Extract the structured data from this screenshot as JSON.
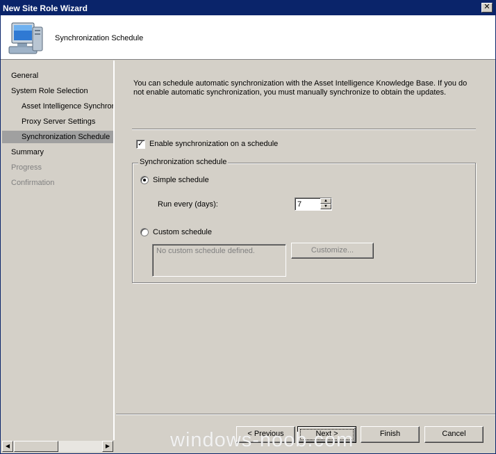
{
  "window": {
    "title": "New Site Role Wizard",
    "close_glyph": "✕"
  },
  "header": {
    "title": "Synchronization Schedule",
    "icon": "computer-monitor-icon"
  },
  "sidebar": {
    "items": [
      {
        "label": "General",
        "state": "normal"
      },
      {
        "label": "System Role Selection",
        "state": "normal"
      },
      {
        "label": "Asset Intelligence Synchron",
        "state": "normal"
      },
      {
        "label": "Proxy Server Settings",
        "state": "normal"
      },
      {
        "label": "Synchronization Schedule",
        "state": "selected"
      },
      {
        "label": "Summary",
        "state": "normal"
      },
      {
        "label": "Progress",
        "state": "disabled"
      },
      {
        "label": "Confirmation",
        "state": "disabled"
      }
    ]
  },
  "main": {
    "description": "You can schedule automatic synchronization with the Asset Intelligence Knowledge Base. If you do not enable automatic synchronization, you must manually synchronize to obtain the updates.",
    "enable_checkbox": {
      "label": "Enable synchronization on a schedule",
      "checked": true
    },
    "group": {
      "legend": "Synchronization schedule",
      "simple": {
        "label": "Simple schedule",
        "selected": true
      },
      "run_every_label": "Run every (days):",
      "run_every_value": "7",
      "custom": {
        "label": "Custom schedule",
        "selected": false
      },
      "custom_placeholder": "No custom schedule defined.",
      "customize_button": "Customize..."
    }
  },
  "footer": {
    "previous": "< Previous",
    "next": "Next >",
    "finish": "Finish",
    "cancel": "Cancel"
  },
  "watermark": "windows-noob.com",
  "colors": {
    "title_bar": "#0a246a",
    "face": "#d4d0c8",
    "selected": "#a0a0a0",
    "disabled_text": "#808080"
  }
}
